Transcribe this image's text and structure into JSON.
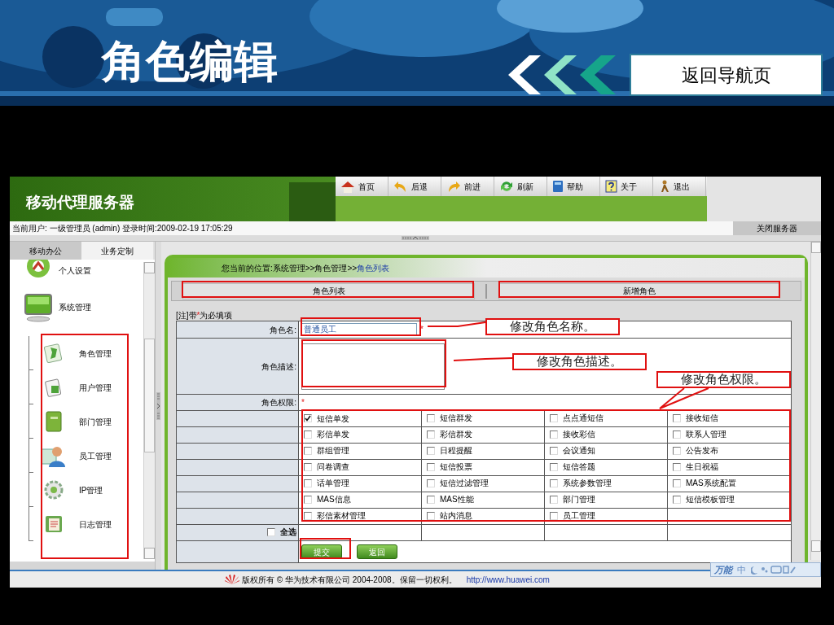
{
  "slide": {
    "title": "角色编辑",
    "nav_button": "返回导航页"
  },
  "app": {
    "title": "移动代理服务器",
    "toolbar": [
      {
        "label": "首页"
      },
      {
        "label": "后退"
      },
      {
        "label": "前进"
      },
      {
        "label": "刷新"
      },
      {
        "label": "帮助"
      },
      {
        "label": "关于"
      },
      {
        "label": "退出"
      }
    ],
    "user_info": "当前用户: 一级管理员 (admin) 登录时间:2009-02-19 17:05:29",
    "close_button": "关闭服务器",
    "sidebar": {
      "tabs": [
        {
          "label": "移动办公",
          "selected": false
        },
        {
          "label": "业务定制",
          "selected": true
        }
      ],
      "items": [
        {
          "label": "个人设置"
        },
        {
          "label": "系统管理",
          "children": [
            {
              "label": "角色管理"
            },
            {
              "label": "用户管理"
            },
            {
              "label": "部门管理"
            },
            {
              "label": "员工管理"
            },
            {
              "label": "IP管理"
            },
            {
              "label": "日志管理"
            }
          ]
        }
      ]
    },
    "breadcrumb": {
      "path": "您当前的位置:系统管理>>角色管理>>",
      "current": "角色列表"
    },
    "actions": [
      "角色列表",
      "新增角色"
    ],
    "note": {
      "prefix": "[注]带",
      "mark": "*",
      "suffix": "为必填项"
    },
    "form": {
      "name_label": "角色名:",
      "name_value": "普通员工",
      "name_mark": "*",
      "description_label": "角色描述:",
      "permissions_label": "角色权限:",
      "permissions_mark": "*",
      "permissions": [
        {
          "label": "短信单发",
          "checked": true
        },
        {
          "label": "短信群发",
          "checked": false
        },
        {
          "label": "点点通短信",
          "checked": false
        },
        {
          "label": "接收短信",
          "checked": false
        },
        {
          "label": "彩信单发",
          "checked": false
        },
        {
          "label": "彩信群发",
          "checked": false
        },
        {
          "label": "接收彩信",
          "checked": false
        },
        {
          "label": "联系人管理",
          "checked": false
        },
        {
          "label": "群组管理",
          "checked": false
        },
        {
          "label": "日程提醒",
          "checked": false
        },
        {
          "label": "会议通知",
          "checked": false
        },
        {
          "label": "公告发布",
          "checked": false
        },
        {
          "label": "问卷调查",
          "checked": false
        },
        {
          "label": "短信投票",
          "checked": false
        },
        {
          "label": "短信答题",
          "checked": false
        },
        {
          "label": "生日祝福",
          "checked": false
        },
        {
          "label": "话单管理",
          "checked": false
        },
        {
          "label": "短信过滤管理",
          "checked": false
        },
        {
          "label": "系统参数管理",
          "checked": false
        },
        {
          "label": "MAS系统配置",
          "checked": false
        },
        {
          "label": "MAS信息",
          "checked": false
        },
        {
          "label": "MAS性能",
          "checked": false
        },
        {
          "label": "部门管理",
          "checked": false
        },
        {
          "label": "短信模板管理",
          "checked": false
        },
        {
          "label": "彩信素材管理",
          "checked": false
        },
        {
          "label": "站内消息",
          "checked": false
        },
        {
          "label": "员工管理",
          "checked": false
        }
      ],
      "select_all": {
        "label": "全选",
        "checked": false
      },
      "buttons": [
        "提交",
        "返回"
      ]
    },
    "footer": {
      "copyright": "版权所有 © 华为技术有限公司 2004-2008。保留一切权利。",
      "link": "http://www.huawei.com"
    },
    "ime_bar": {
      "label": "万能",
      "mode": "中"
    }
  },
  "callouts": [
    "修改角色名称。",
    "修改角色描述。",
    "修改角色权限。"
  ]
}
